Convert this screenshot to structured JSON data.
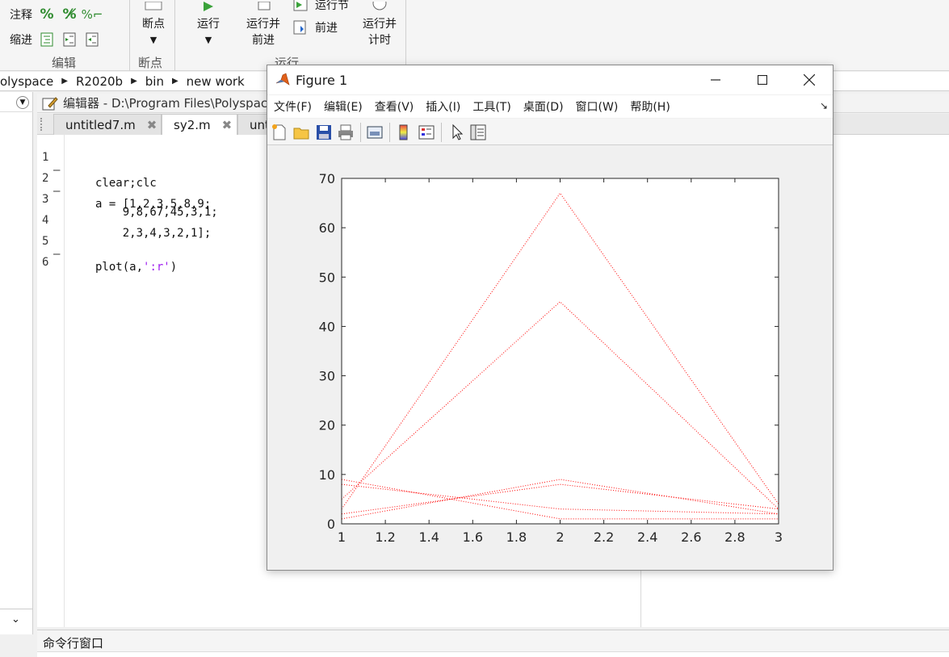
{
  "ribbon": {
    "comment_label": "注释",
    "indent_label": "缩进",
    "edit_group": "编辑",
    "breakpoint_label": "断点",
    "breakpoint_group": "断点",
    "run_label": "运行",
    "run_advance_label_1": "运行并",
    "run_advance_label_2": "前进",
    "run_section_label": "运行节",
    "advance_label": "前进",
    "run_time_label_1": "运行并",
    "run_time_label_2": "计时",
    "run_group": "运行"
  },
  "address": {
    "crumbs": [
      "olyspace",
      "R2020b",
      "bin",
      "new work"
    ]
  },
  "editor": {
    "title": "编辑器 - D:\\Program Files\\Polyspace",
    "tabs": [
      {
        "label": "untitled7.m",
        "active": false
      },
      {
        "label": "sy2.m",
        "active": true
      },
      {
        "label": "unt",
        "active": false
      }
    ],
    "lines": [
      {
        "num": "1",
        "dash": "—",
        "code": "clear;clc"
      },
      {
        "num": "2",
        "dash": "—",
        "code": "a = [1,2,3,5,8,9;"
      },
      {
        "num": "3",
        "dash": "",
        "code": "    9,8,67,45,3,1;"
      },
      {
        "num": "4",
        "dash": "",
        "code": "    2,3,4,3,2,1];"
      },
      {
        "num": "5",
        "dash": "—",
        "code_pre": "plot(a,",
        "code_str": "':r'",
        "code_post": ")"
      },
      {
        "num": "6",
        "dash": "",
        "code": ""
      }
    ]
  },
  "command_window": {
    "title": "命令行窗口"
  },
  "figure": {
    "title": "Figure 1",
    "menus": [
      "文件(F)",
      "编辑(E)",
      "查看(V)",
      "插入(I)",
      "工具(T)",
      "桌面(D)",
      "窗口(W)",
      "帮助(H)"
    ],
    "line_color": "#ff0000"
  },
  "chart_data": {
    "type": "line",
    "x": [
      1,
      2,
      3
    ],
    "series": [
      {
        "values": [
          1,
          9,
          2
        ]
      },
      {
        "values": [
          2,
          8,
          3
        ]
      },
      {
        "values": [
          3,
          67,
          4
        ]
      },
      {
        "values": [
          5,
          45,
          3
        ]
      },
      {
        "values": [
          8,
          3,
          2
        ]
      },
      {
        "values": [
          9,
          1,
          1
        ]
      }
    ],
    "xlim": [
      1,
      3
    ],
    "ylim": [
      0,
      70
    ],
    "xticks": [
      "1",
      "1.2",
      "1.4",
      "1.6",
      "1.8",
      "2",
      "2.2",
      "2.4",
      "2.6",
      "2.8",
      "3"
    ],
    "yticks": [
      "0",
      "10",
      "20",
      "30",
      "40",
      "50",
      "60",
      "70"
    ],
    "line_style": "dotted",
    "grid": false
  }
}
